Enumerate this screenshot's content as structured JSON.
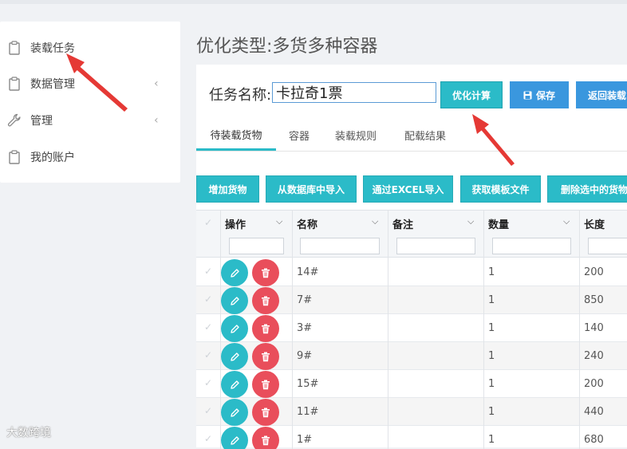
{
  "sidebar": {
    "items": [
      {
        "label": "装载任务",
        "icon": "clipboard-icon",
        "has_chevron": false
      },
      {
        "label": "数据管理",
        "icon": "clipboard-icon",
        "has_chevron": true
      },
      {
        "label": "管理",
        "icon": "wrench-icon",
        "has_chevron": true
      },
      {
        "label": "我的账户",
        "icon": "clipboard-icon",
        "has_chevron": false
      }
    ],
    "chevron": "‹"
  },
  "page": {
    "title": "优化类型:多货多种容器"
  },
  "task": {
    "label": "任务名称:",
    "value": "卡拉奇1票"
  },
  "actions": {
    "optimize": "优化计算",
    "save": "保存",
    "back": "返回装载"
  },
  "tabs": [
    "待装载货物",
    "容器",
    "装载规则",
    "配载结果"
  ],
  "toolbar": {
    "add": "增加货物",
    "import_db": "从数据库中导入",
    "import_excel": "通过EXCEL导入",
    "template": "获取模板文件",
    "delete_selected": "删除选中的货物"
  },
  "table": {
    "headers": [
      "操作",
      "名称",
      "备注",
      "数量",
      "长度"
    ],
    "rows": [
      {
        "name": "14#",
        "note": "",
        "qty": "1",
        "length": "200"
      },
      {
        "name": "7#",
        "note": "",
        "qty": "1",
        "length": "850"
      },
      {
        "name": "3#",
        "note": "",
        "qty": "1",
        "length": "140"
      },
      {
        "name": "9#",
        "note": "",
        "qty": "1",
        "length": "240"
      },
      {
        "name": "15#",
        "note": "",
        "qty": "1",
        "length": "200"
      },
      {
        "name": "11#",
        "note": "",
        "qty": "1",
        "length": "440"
      },
      {
        "name": "1#",
        "note": "",
        "qty": "1",
        "length": "680"
      }
    ]
  },
  "watermark": "大数跨境",
  "colors": {
    "teal": "#2bbbc8",
    "blue": "#3a97de",
    "delete_red": "#e94e5b",
    "annotation_arrow": "#e53935"
  }
}
